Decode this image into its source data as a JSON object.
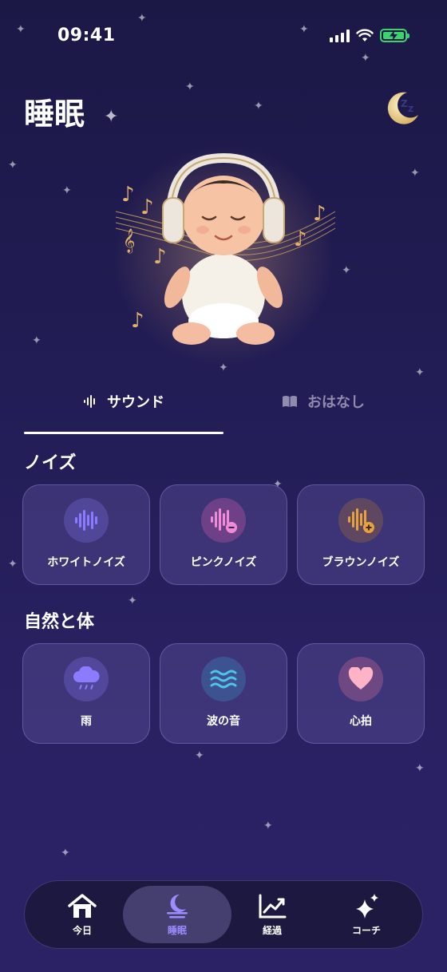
{
  "status": {
    "time": "09:41"
  },
  "header": {
    "title": "睡眠"
  },
  "tabs": [
    {
      "label": "サウンド",
      "icon": "waveform-icon",
      "active": true
    },
    {
      "label": "おはなし",
      "icon": "book-icon",
      "active": false
    }
  ],
  "sections": {
    "noise": {
      "title": "ノイズ",
      "items": [
        {
          "label": "ホワイトノイズ",
          "icon": "waveform-icon",
          "color": "#8b7cff"
        },
        {
          "label": "ピンクノイズ",
          "icon": "waveform-minus-icon",
          "color": "#f08ad6"
        },
        {
          "label": "ブラウンノイズ",
          "icon": "waveform-plus-icon",
          "color": "#e8a23a"
        }
      ]
    },
    "nature": {
      "title": "自然と体",
      "items": [
        {
          "label": "雨",
          "icon": "rain-cloud-icon",
          "color": "#8b7cff"
        },
        {
          "label": "波の音",
          "icon": "waves-icon",
          "color": "#4fc3e8"
        },
        {
          "label": "心拍",
          "icon": "heart-icon",
          "color": "#ffb3c6"
        }
      ]
    }
  },
  "nav": [
    {
      "label": "今日",
      "icon": "home-icon",
      "active": false
    },
    {
      "label": "睡眠",
      "icon": "moon-icon",
      "active": true
    },
    {
      "label": "経過",
      "icon": "chart-line-icon",
      "active": false
    },
    {
      "label": "コーチ",
      "icon": "sparkles-icon",
      "active": false
    }
  ],
  "colors": {
    "accent": "#9b8cff",
    "background": "#221d55",
    "battery": "#3bd46a"
  }
}
